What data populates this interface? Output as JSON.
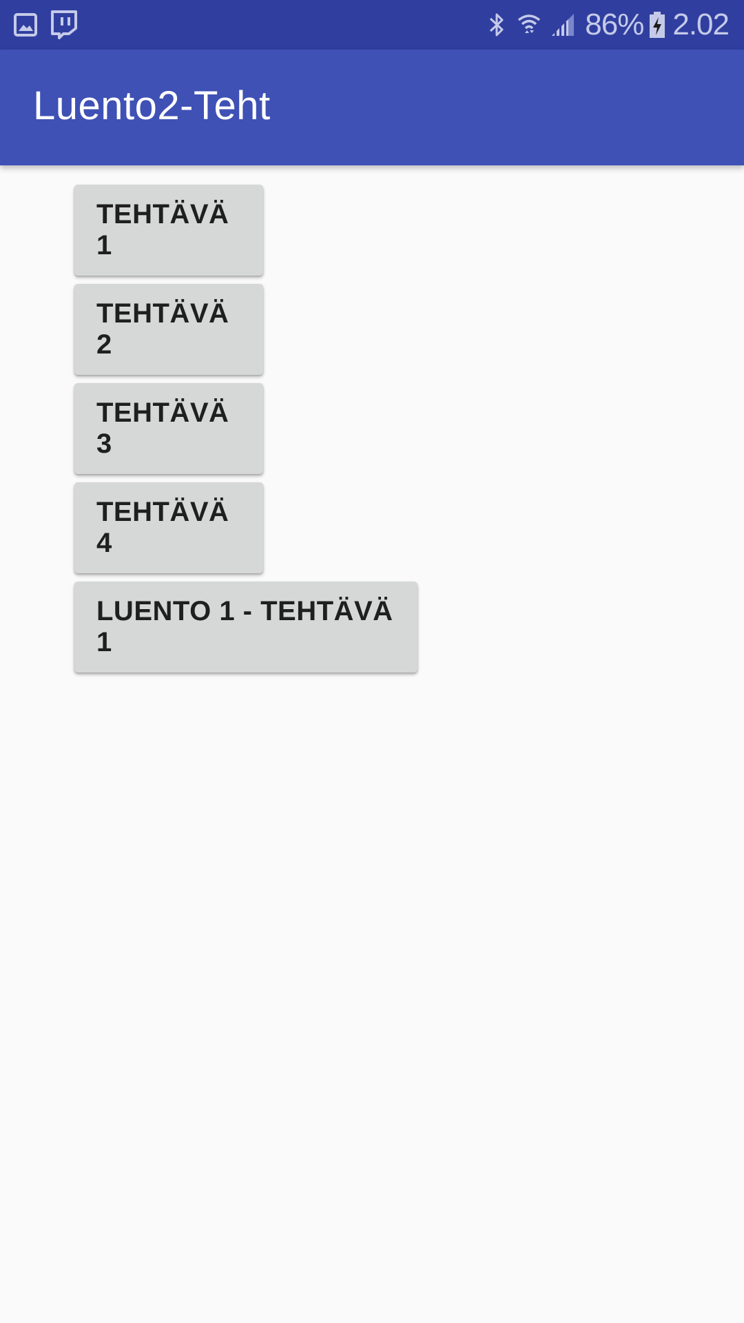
{
  "status_bar": {
    "left_icons": [
      "gallery-icon",
      "twitch-icon"
    ],
    "right_icons": [
      "bluetooth-icon",
      "wifi-icon",
      "cell-signal-icon",
      "battery-charging-icon"
    ],
    "battery_percent": "86%",
    "time": "2.02",
    "colors": {
      "background": "#303f9f",
      "icon": "#c5cae9"
    }
  },
  "app_bar": {
    "title": "Luento2-Teht",
    "color": "#3f51b5"
  },
  "buttons": [
    {
      "label": "TEHTÄVÄ 1"
    },
    {
      "label": "TEHTÄVÄ 2"
    },
    {
      "label": "TEHTÄVÄ 3"
    },
    {
      "label": "TEHTÄVÄ 4"
    },
    {
      "label": "LUENTO 1 - TEHTÄVÄ 1"
    }
  ]
}
